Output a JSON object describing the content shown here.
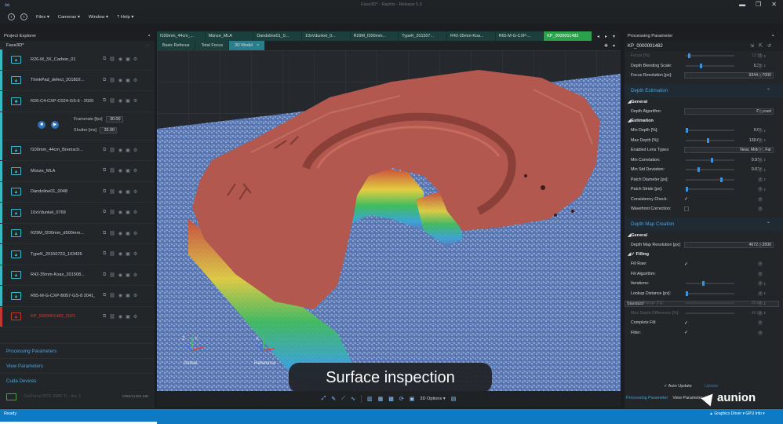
{
  "app": {
    "title": "Face3D* - Raytrix - Release 5.0"
  },
  "menu": [
    {
      "label": "Files ▾"
    },
    {
      "label": "Cameras ▾"
    },
    {
      "label": "Window ▾"
    },
    {
      "label": "? Help ▾"
    }
  ],
  "project_explorer": {
    "title": "Project Explorer",
    "project": "Face3D*",
    "items": [
      {
        "name": "R26-M_3X_Carbon_01",
        "kind": "image"
      },
      {
        "name": "ThinkPad_defect_201802...",
        "kind": "image"
      },
      {
        "name": "R26-C4-CXP-C024-GS-6 - 2020",
        "kind": "camera"
      },
      {
        "name": "f100mm_44cm_Bremsch...",
        "kind": "image"
      },
      {
        "name": "Münze_MLA",
        "kind": "image"
      },
      {
        "name": "Dandoline01_0048",
        "kind": "image"
      },
      {
        "name": "10xVdunkel_0769",
        "kind": "image"
      },
      {
        "name": "R29M_f200mm_d500mm...",
        "kind": "image"
      },
      {
        "name": "TypeK_20150723_103426",
        "kind": "image"
      },
      {
        "name": "R42-35mm-Koax_201508...",
        "kind": "image"
      },
      {
        "name": "R65-M-G-CXP-B057-GS-8 2041_20190306_104305",
        "kind": "image"
      },
      {
        "name": "KP_0000001482_2021",
        "kind": "error"
      }
    ],
    "camera": {
      "framerate_label": "Framerate [fps]",
      "framerate": "30.00",
      "shutter_label": "Shutter [ms]",
      "shutter": "33.00"
    },
    "sections": [
      "Processing Parameters",
      "View Parameters",
      "Cuda Devices"
    ],
    "gpu": {
      "name": "GeForce RTX 2080 Ti - Arc 1",
      "mem": "1050/11264 MB"
    }
  },
  "tabs": [
    {
      "label": "f100mm_44cm_..."
    },
    {
      "label": "Münze_MLA"
    },
    {
      "label": "Dandoline01_0..."
    },
    {
      "label": "10xVdunkel_0..."
    },
    {
      "label": "R29M_f200mm..."
    },
    {
      "label": "TypeK_201507..."
    },
    {
      "label": "R42-35mm-Koa..."
    },
    {
      "label": "R65-M-G-CXP-..."
    },
    {
      "label": "KP_0000001482",
      "active": true
    }
  ],
  "view_tabs": [
    {
      "label": "Basic Refocus"
    },
    {
      "label": "Total Focus"
    },
    {
      "label": "3D Model",
      "active": true
    }
  ],
  "viewport": {
    "axes": {
      "global": "Global",
      "reference": "Reference",
      "x": "X",
      "y": "Y",
      "z": "Z"
    },
    "caption": "Surface inspection"
  },
  "toolbar_bottom": {
    "options": "3D Options ▾"
  },
  "params": {
    "title": "Processing Parameter",
    "dataset": "KP_0000001482",
    "top_rows": [
      {
        "label": "Focus [%]:",
        "value": "13.50",
        "knob": 0.05,
        "dim": true
      },
      {
        "label": "Depth Blending Scale:",
        "value": "0.28",
        "knob": 0.3
      },
      {
        "label": "Focus Resolution [px]:",
        "dropdown": "9344 x 7000"
      }
    ],
    "depth_estimation": {
      "title": "Depth Estimation",
      "general": "General",
      "algorithm_label": "Depth Algorithm:",
      "algorithm": "Raycast",
      "estimation": "Estimation",
      "rows": [
        {
          "label": "Min Depth [%]:",
          "value": "0.00",
          "knob": 0.0
        },
        {
          "label": "Max Depth [%]:",
          "value": "130.00",
          "knob": 0.45
        },
        {
          "label": "Enabled Lens Types:",
          "dropdown": "Near, Middle, Far"
        },
        {
          "label": "Min Correlation:",
          "value": "0.915",
          "knob": 0.55
        },
        {
          "label": "Min Std Deviation:",
          "value": "0.015",
          "knob": 0.25
        },
        {
          "label": "Patch Diameter [px]:",
          "value": "5",
          "knob": 0.75
        },
        {
          "label": "Patch Stride [px]:",
          "value": "1",
          "knob": 0.0
        },
        {
          "label": "Consistency Check:",
          "check": true
        },
        {
          "label": "Wavefront Correction:",
          "check": false
        }
      ]
    },
    "depth_map": {
      "title": "Depth Map Creation",
      "general": "General",
      "resolution_label": "Depth Map Resolution [px]:",
      "resolution": "4672 x 3500",
      "filling": "✓  Filling",
      "rows": [
        {
          "label": "Fill Raw:",
          "check": true
        },
        {
          "label": "Fill Algorithm:",
          "dropdown": "Standard",
          "left": true
        },
        {
          "label": "Iterations:",
          "value": "5",
          "knob": 0.35
        },
        {
          "label": "Lookup Distance [px]:",
          "value": "4",
          "knob": 0.0
        },
        {
          "label": "Depth Range [%]:",
          "value": "20.00",
          "dim": true
        },
        {
          "label": "Max Depth Difference [%]:",
          "value": "45.00",
          "dim": true
        },
        {
          "label": "Complete Fill:",
          "check": true
        },
        {
          "label": "Filter:",
          "check": true
        }
      ]
    },
    "auto_update": "✓  Auto Update",
    "update": "Update",
    "bottom_tabs": [
      "Processing Parameter",
      "View Parameter"
    ]
  },
  "brand": "aunion",
  "status": {
    "ready": "Ready",
    "driver": "▲ Graphics Driver ▾  GPU Info ▾"
  },
  "colors": {
    "accent": "#3fb5c9",
    "active_tab": "#2aa14b",
    "status": "#0e7ac3",
    "link": "#4aa3e0",
    "coin": "#b2584e"
  }
}
